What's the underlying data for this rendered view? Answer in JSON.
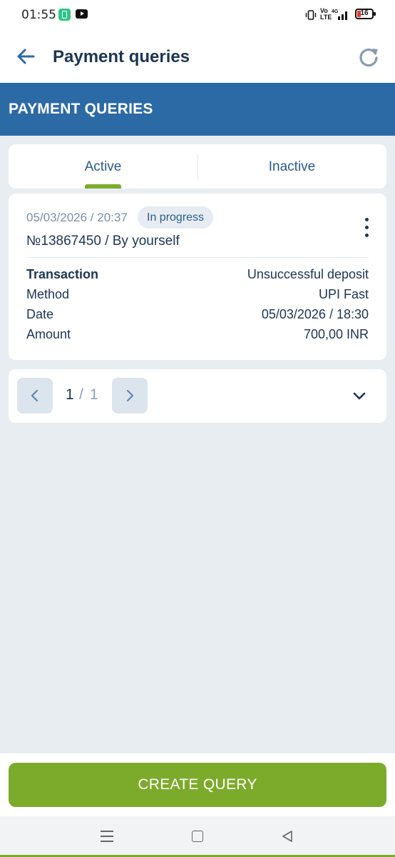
{
  "status_bar": {
    "time": "01:55",
    "volte_label": "Vo LTE",
    "network_label": "4G",
    "battery_level": "16"
  },
  "app_bar": {
    "title": "Payment queries"
  },
  "banner": {
    "title": "PAYMENT QUERIES"
  },
  "tabs": [
    {
      "label": "Active",
      "selected": true
    },
    {
      "label": "Inactive",
      "selected": false
    }
  ],
  "query": {
    "datetime": "05/03/2026 / 20:37",
    "status": "In progress",
    "number_line": "№13867450 / By yourself",
    "details": [
      {
        "label": "Transaction",
        "value": "Unsuccessful deposit"
      },
      {
        "label": "Method",
        "value": "UPI Fast"
      },
      {
        "label": "Date",
        "value": "05/03/2026 / 18:30"
      },
      {
        "label": "Amount",
        "value": "700,00 INR"
      }
    ]
  },
  "pagination": {
    "current": "1",
    "separator": "/",
    "total": "1"
  },
  "actions": {
    "create_query": "CREATE QUERY"
  },
  "colors": {
    "primary_blue": "#2c6aa6",
    "accent_green": "#7cab2c",
    "text_dark": "#1c3553",
    "background": "#e8edf1"
  }
}
